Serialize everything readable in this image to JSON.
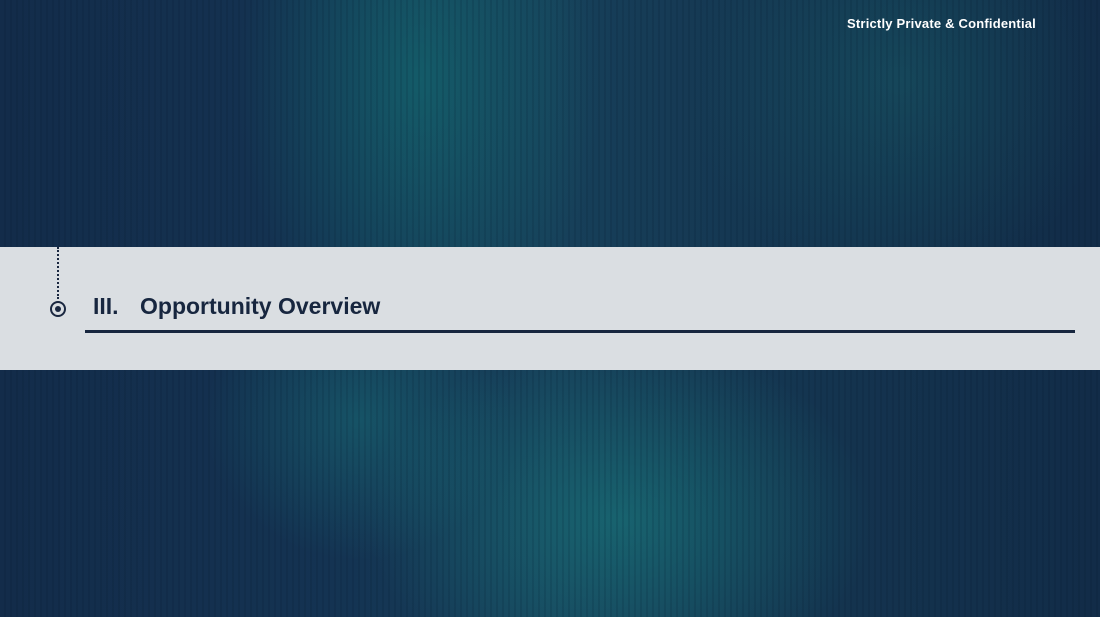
{
  "header": {
    "confidential_label": "Strictly Private & Confidential"
  },
  "section": {
    "number": "III.",
    "title": "Opportunity Overview"
  },
  "colors": {
    "background_dark": "#132c4a",
    "background_teal": "#17405a",
    "band": "#dadee2",
    "title_text": "#17263f",
    "header_text": "#ffffff"
  },
  "icons": {
    "section_marker": "target-circle-icon"
  }
}
